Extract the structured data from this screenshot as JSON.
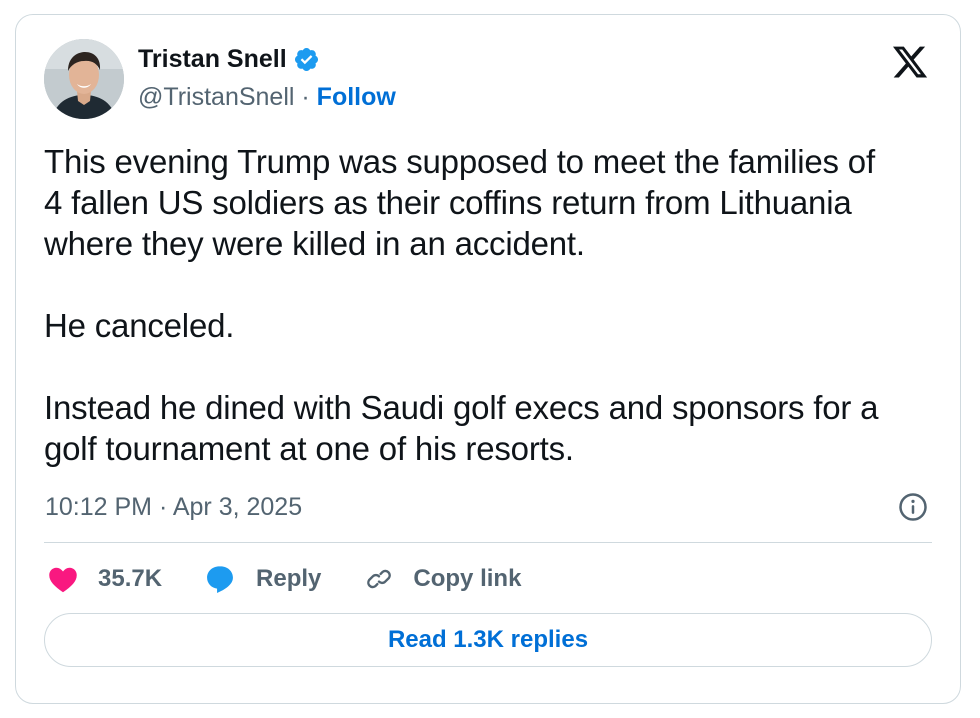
{
  "author": {
    "name": "Tristan Snell",
    "handle": "@TristanSnell",
    "separator": " · ",
    "follow_label": "Follow"
  },
  "tweet": {
    "paragraphs": [
      [
        "This evening Trump was supposed to meet the families of",
        "4 fallen US soldiers as their coffins return from Lithuania",
        "where they were killed in an accident."
      ],
      [
        "He canceled."
      ],
      [
        "Instead he dined with Saudi golf execs and sponsors for a",
        "golf tournament at one of his resorts."
      ]
    ],
    "timestamp": "10:12 PM · Apr 3, 2025"
  },
  "actions": {
    "like_count": "35.7K",
    "reply_label": "Reply",
    "copy_link_label": "Copy link",
    "read_replies_label": "Read 1.3K replies"
  },
  "icons": {
    "verified": "verified-badge-icon",
    "x_logo": "x-logo-icon",
    "info": "info-icon",
    "like": "heart-icon",
    "reply": "speech-bubble-icon",
    "copy": "link-icon"
  },
  "colors": {
    "text": "#0f1419",
    "secondary": "#536471",
    "link": "#006fd6",
    "verified": "#1d9bf0",
    "like": "#f91880",
    "reply": "#1d9bf0",
    "border": "#cfd9de"
  }
}
